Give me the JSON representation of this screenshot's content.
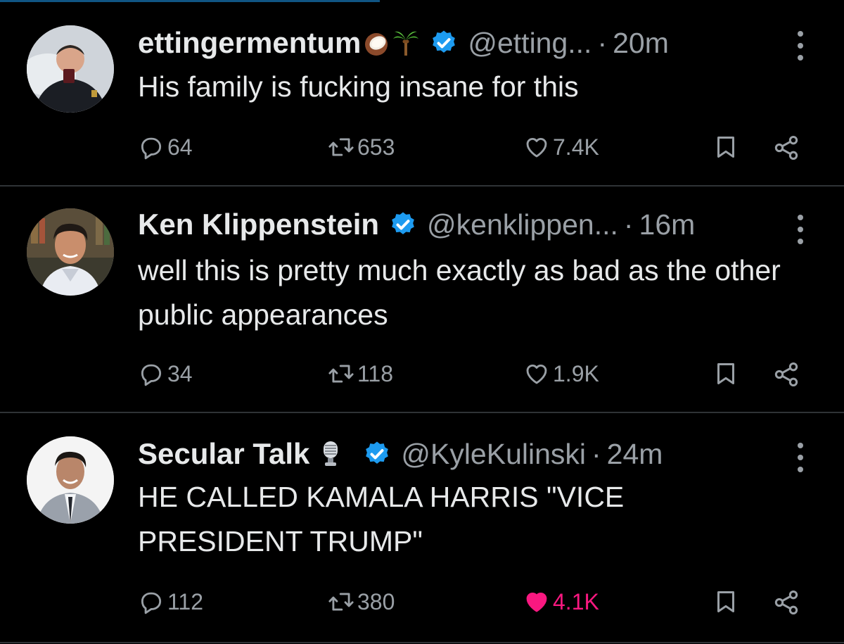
{
  "tweets": [
    {
      "name": "ettingermentum",
      "name_emojis": [
        "coconut-emoji",
        "palm-tree-emoji"
      ],
      "handle": "@etting...",
      "time": "20m",
      "text": "His family is fucking insane for this",
      "replies": "64",
      "reposts": "653",
      "likes": "7.4K",
      "liked": false
    },
    {
      "name": "Ken Klippenstein",
      "name_emojis": [],
      "handle": "@kenklippen...",
      "time": "16m",
      "text": "well this is pretty much exactly as bad as the other public appearances",
      "replies": "34",
      "reposts": "118",
      "likes": "1.9K",
      "liked": false
    },
    {
      "name": "Secular Talk",
      "name_emojis": [
        "microphone-emoji"
      ],
      "handle": "@KyleKulinski",
      "time": "24m",
      "text": "HE CALLED KAMALA HARRIS \"VICE PRESIDENT TRUMP\"",
      "replies": "112",
      "reposts": "380",
      "likes": "4.1K",
      "liked": true
    }
  ],
  "colors": {
    "background": "#000000",
    "text": "#e7e9ea",
    "muted": "#9aa0a6",
    "verified": "#1d9bf0",
    "like": "#f91880",
    "divider": "#2f3336"
  },
  "icons": [
    "reply-icon",
    "repost-icon",
    "like-icon",
    "bookmark-icon",
    "share-icon",
    "more-icon",
    "verified-badge-icon"
  ],
  "dot": "·"
}
